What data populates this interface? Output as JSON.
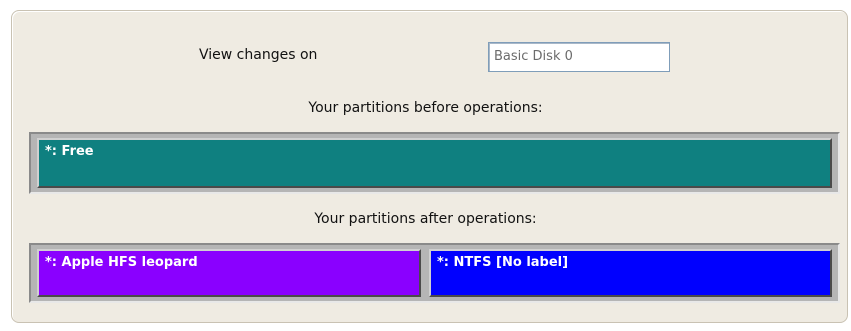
{
  "view": {
    "label": "View changes on",
    "disk": "Basic Disk 0"
  },
  "before": {
    "title": "Your partitions before operations:",
    "partitions": [
      {
        "label": "*: Free",
        "color": "#0f8080"
      }
    ]
  },
  "after": {
    "title": "Your partitions after operations:",
    "partitions": [
      {
        "label": "*: Apple HFS leopard",
        "color": "#8a00ff"
      },
      {
        "label": "*: NTFS [No label]",
        "color": "#0000ff"
      }
    ]
  }
}
